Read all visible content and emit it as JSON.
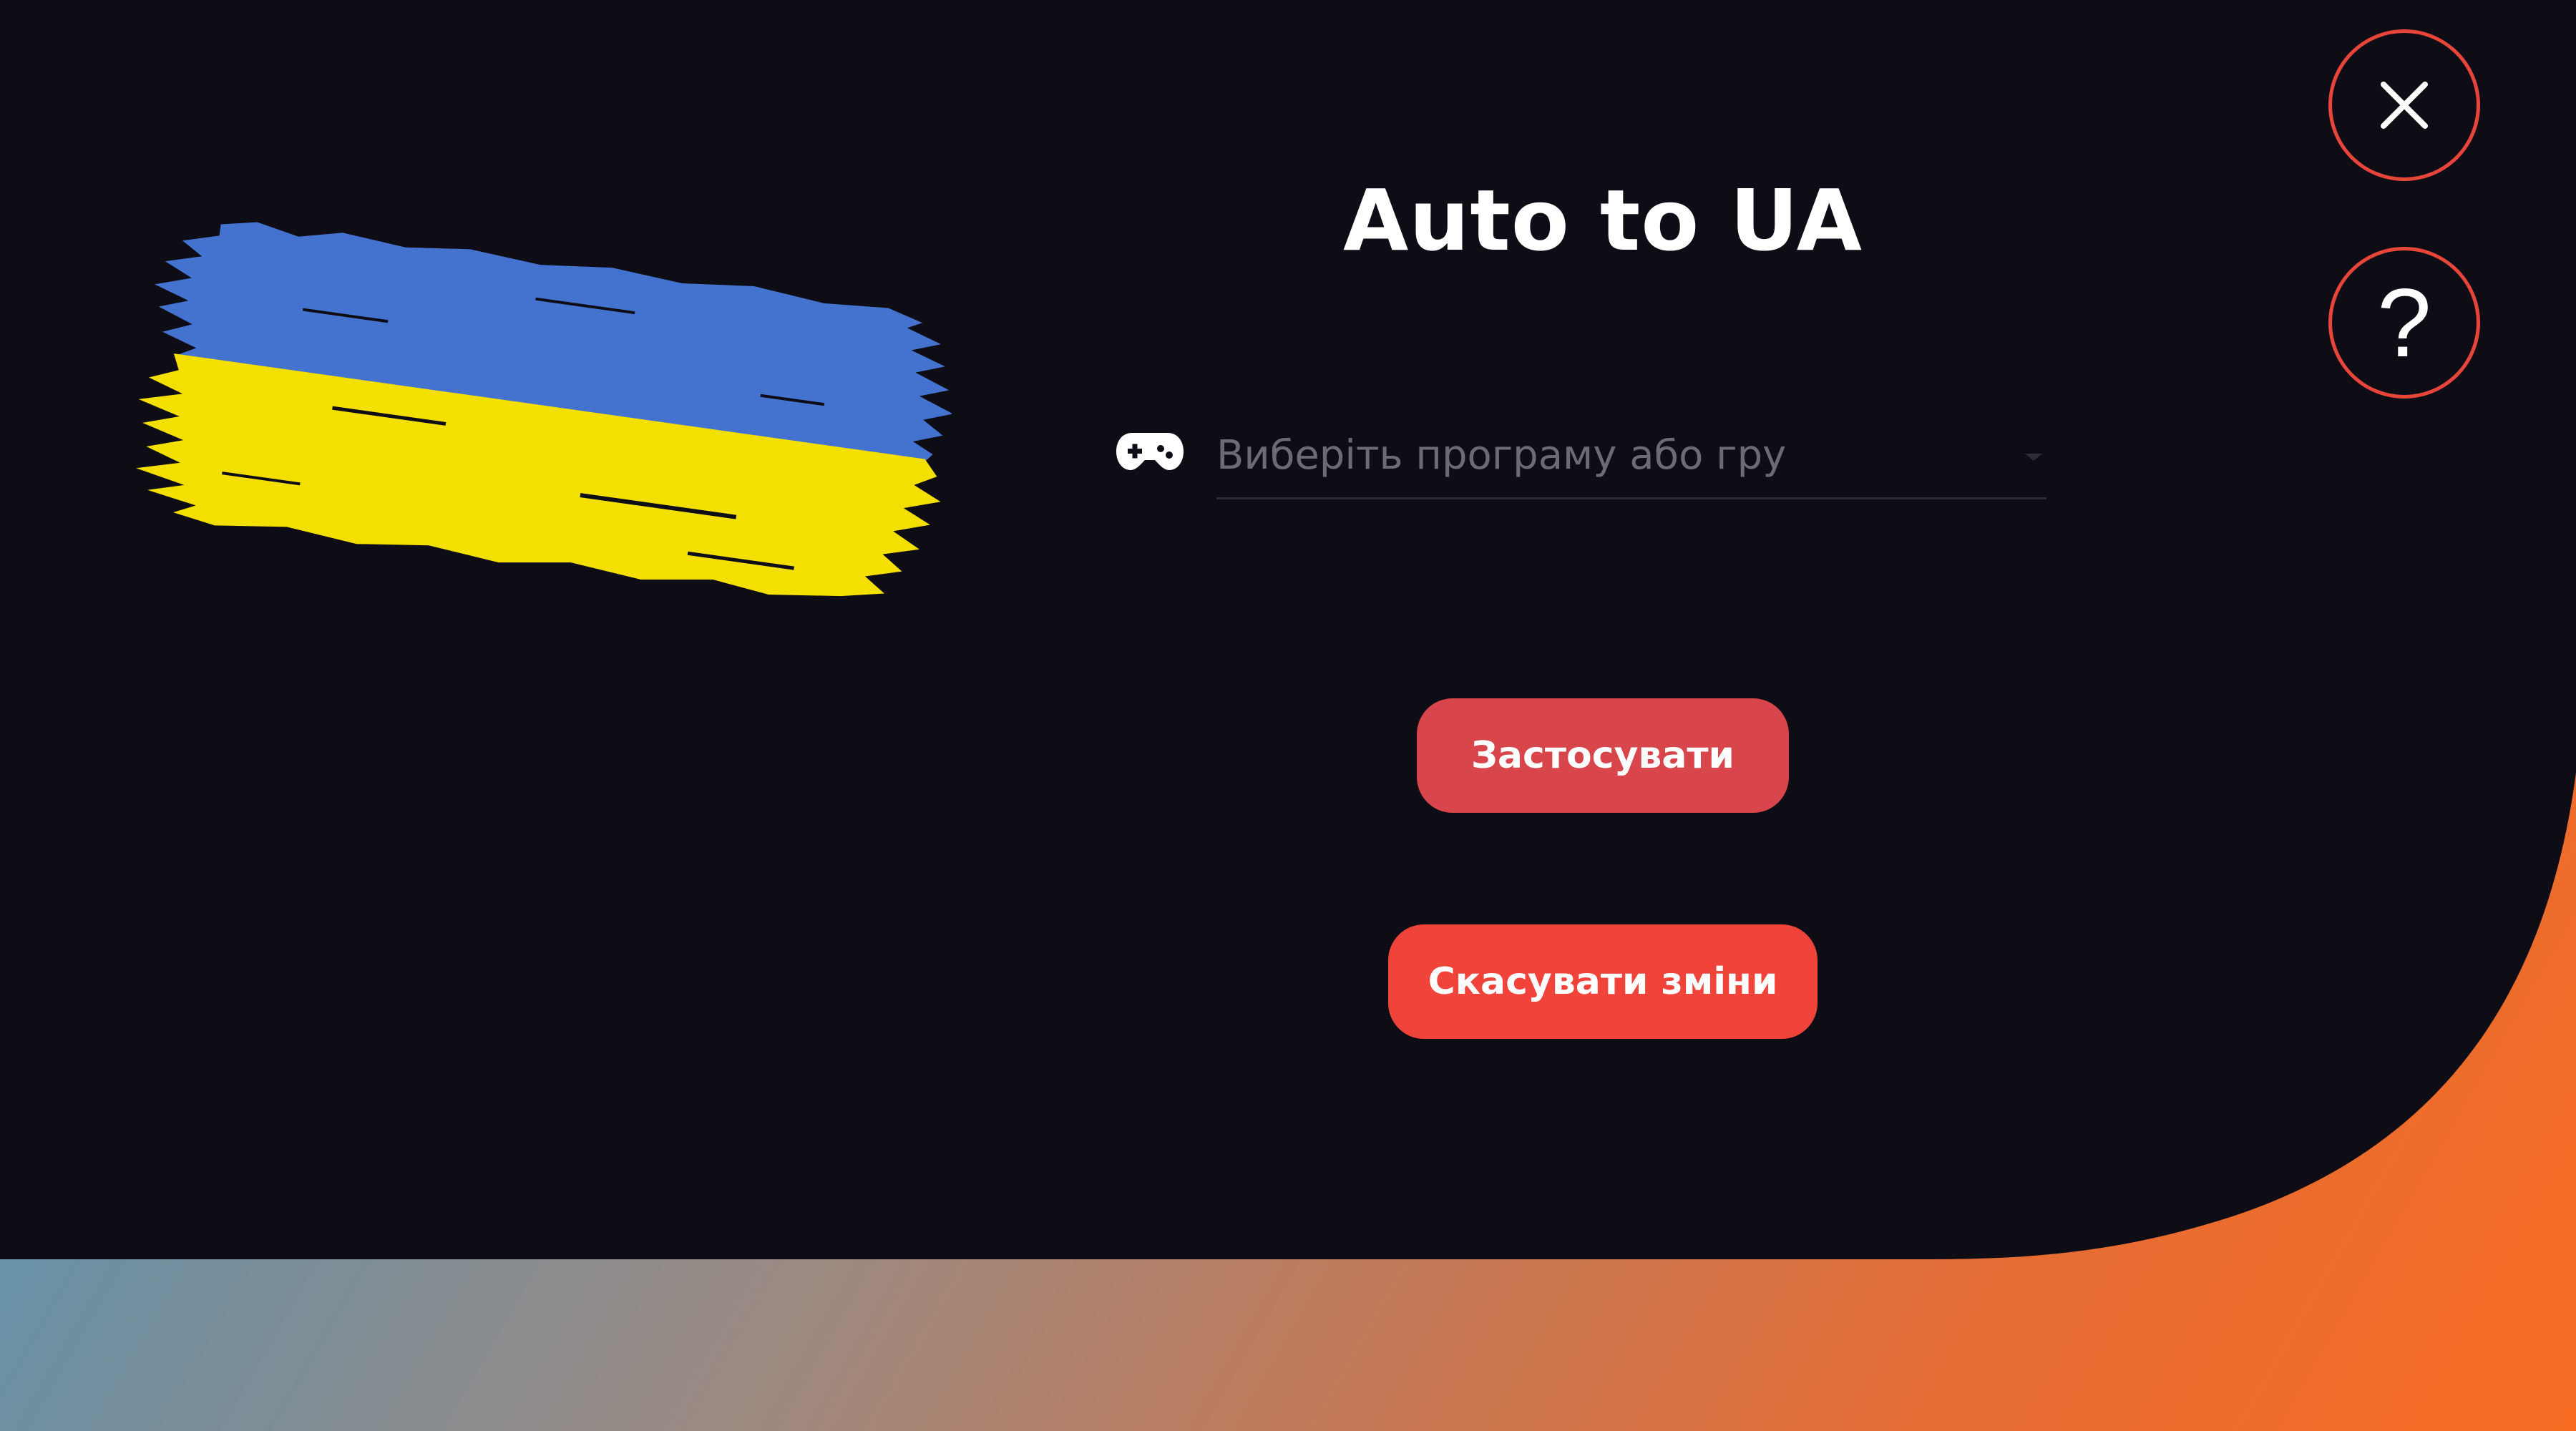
{
  "window": {
    "title": "Auto to UA"
  },
  "controls": {
    "close_icon": "close-icon",
    "help_icon": "question-mark-icon",
    "help_label": "?"
  },
  "selector": {
    "icon": "gamepad-icon",
    "placeholder": "Виберіть програму або гру"
  },
  "actions": {
    "apply_label": "Застосувати",
    "cancel_label": "Скасувати зміни"
  },
  "colors": {
    "panel_bg": "#0e0d16",
    "accent_red": "#e8453a",
    "apply_bg": "#d8464b",
    "cancel_bg": "#f0443a",
    "flag_blue": "#4472cf",
    "flag_yellow": "#f3df00",
    "gradient_start": "#3aa4d9",
    "gradient_end": "#f76b22"
  }
}
